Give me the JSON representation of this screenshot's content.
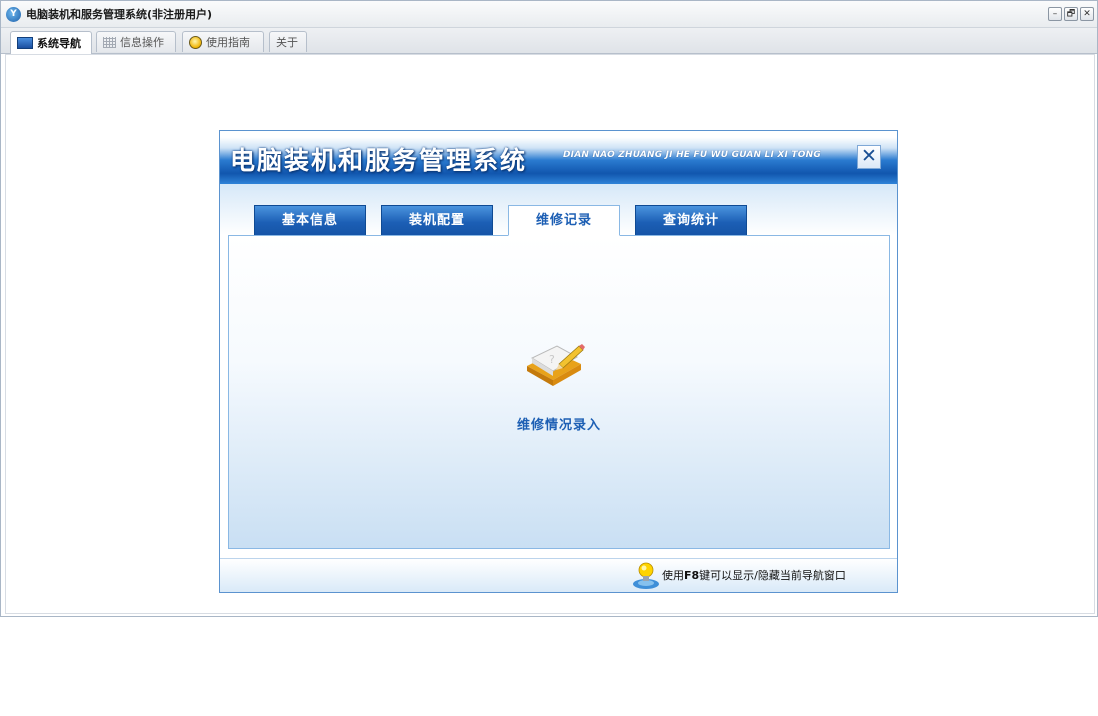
{
  "window": {
    "title": "电脑装机和服务管理系统(非注册用户)",
    "icon": "app-logo-icon",
    "controls": {
      "minimize": "–",
      "restore": "🗗",
      "close": "✕"
    }
  },
  "top_tabs": [
    {
      "label": "系统导航",
      "icon": "monitor-icon",
      "active": true
    },
    {
      "label": "信息操作",
      "icon": "grid-icon",
      "active": false
    },
    {
      "label": "使用指南",
      "icon": "lightbulb-icon",
      "active": false
    },
    {
      "label": "关于",
      "icon": "",
      "active": false
    }
  ],
  "panel": {
    "title": "电脑装机和服务管理系统",
    "subtitle": "DIAN NAO ZHUANG JI HE FU WU GUAN LI XI TONG",
    "close": "✕",
    "tabs": [
      {
        "label": "基本信息",
        "active": false
      },
      {
        "label": "装机配置",
        "active": false
      },
      {
        "label": "维修记录",
        "active": true
      },
      {
        "label": "查询统计",
        "active": false
      }
    ],
    "task": {
      "label": "维修情况录入",
      "icon": "notepad-pencil-icon"
    },
    "footer": {
      "hint_prefix": "使用",
      "hint_key": "F8",
      "hint_suffix": "键可以显示/隐藏当前导航窗口"
    }
  },
  "colors": {
    "accent": "#1d5fb4",
    "header_dark": "#1156ae",
    "tab_blue": "#1c5fb5",
    "border_blue": "#8ab8e4"
  }
}
